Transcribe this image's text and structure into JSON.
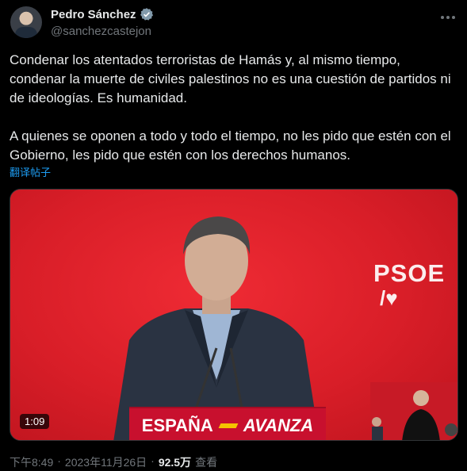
{
  "author": {
    "name": "Pedro Sánchez",
    "handle": "@sanchezcastejon",
    "verified": true
  },
  "tweet": {
    "text": "Condenar los atentados terroristas de Hamás y, al mismo tiempo, condenar la muerte de civiles palestinos no es una cuestión de partidos ni de ideologías. Es humanidad.\n\nA quienes se oponen a todo y todo el tiempo, no les pido que estén con el Gobierno, les pido que estén con los derechos humanos.",
    "translate_label": "翻译帖子"
  },
  "media": {
    "video_duration": "1:09",
    "logo_text": "PSOE",
    "logo_sub": "/♥",
    "lectern_word1": "ESPAÑA",
    "lectern_word2": "AVANZA"
  },
  "footer": {
    "time": "下午8:49",
    "date": "2023年11月26日",
    "views": "92.5万",
    "views_label": "查看",
    "separator": "·"
  },
  "colors": {
    "background": "#000000",
    "text": "#e7e9ea",
    "muted": "#71767b",
    "link": "#1d9bf0",
    "party_red": "#d81f2a"
  },
  "icons": [
    "verified-badge-icon",
    "more-options-icon"
  ]
}
